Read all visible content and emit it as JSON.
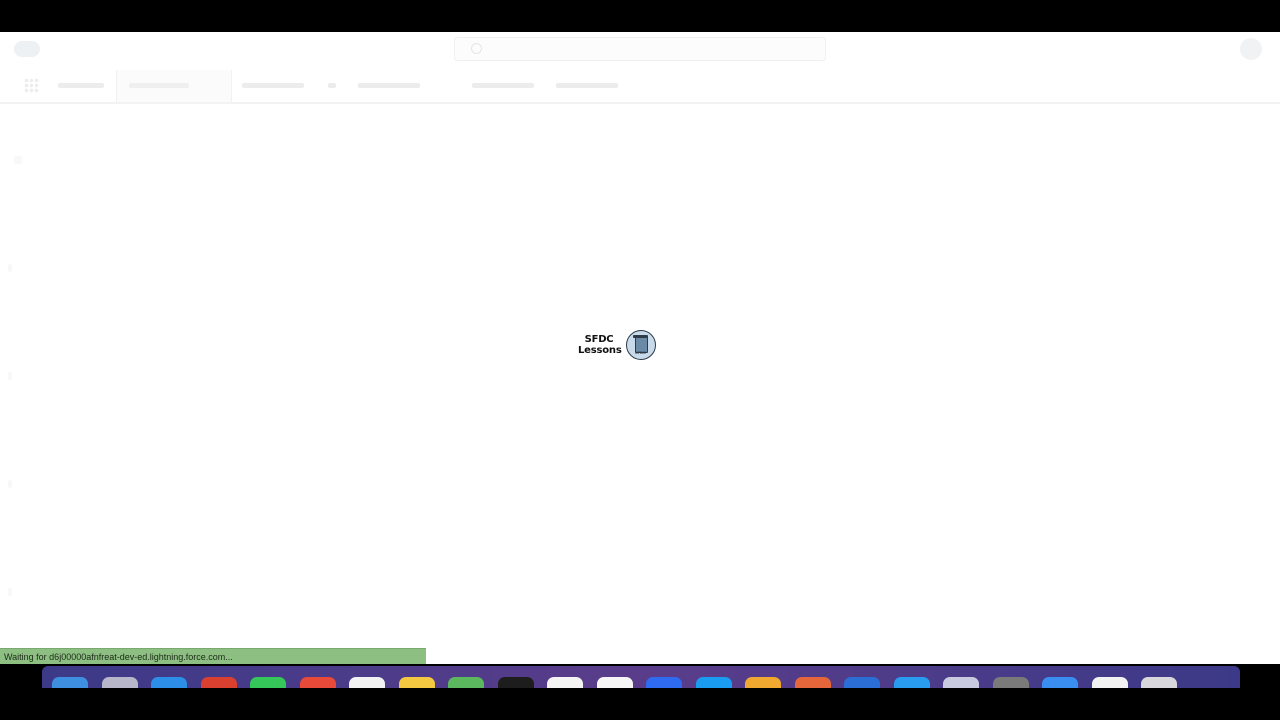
{
  "search": {
    "placeholder": ""
  },
  "brand": {
    "line1": "SFDC",
    "line2": "Lessons",
    "logo_caption": "SFDC"
  },
  "status_bar": {
    "text": "Waiting for d6j00000afnfreat-dev-ed.lightning.force.com..."
  },
  "colors": {
    "status_bar_bg": "#8dbf82",
    "dock_bg": "#4a3d7a"
  },
  "dock": {
    "icons": [
      {
        "name": "finder-icon",
        "color": "#3e8fe0"
      },
      {
        "name": "launchpad-icon",
        "color": "#b7b7c9"
      },
      {
        "name": "safari-icon",
        "color": "#2d8ee8"
      },
      {
        "name": "chrome-icon",
        "color": "#d9402f"
      },
      {
        "name": "messages-icon",
        "color": "#35c759"
      },
      {
        "name": "calendar-icon",
        "color": "#e84a3a"
      },
      {
        "name": "notes-icon",
        "color": "#f2f2f2"
      },
      {
        "name": "stickies-icon",
        "color": "#f5c842"
      },
      {
        "name": "maps-icon",
        "color": "#5bb85e"
      },
      {
        "name": "terminal-icon",
        "color": "#1d1d1d"
      },
      {
        "name": "textedit-icon",
        "color": "#f4f4f4"
      },
      {
        "name": "photos-icon",
        "color": "#f6f6f6"
      },
      {
        "name": "zoom-icon",
        "color": "#2f6bf0"
      },
      {
        "name": "appstore-icon",
        "color": "#1a9cf0"
      },
      {
        "name": "music-icon",
        "color": "#f0a830"
      },
      {
        "name": "powerpoint-icon",
        "color": "#e5663a"
      },
      {
        "name": "word-icon",
        "color": "#2b6fd6"
      },
      {
        "name": "vscode-icon",
        "color": "#2a9cf0"
      },
      {
        "name": "preview-icon",
        "color": "#c8cbe0"
      },
      {
        "name": "system-preferences-icon",
        "color": "#7a7a7a"
      },
      {
        "name": "downloads-icon",
        "color": "#3a8ef0"
      },
      {
        "name": "documents-icon",
        "color": "#f2f2f2"
      },
      {
        "name": "trash-icon",
        "color": "#d7d7dc"
      }
    ]
  }
}
